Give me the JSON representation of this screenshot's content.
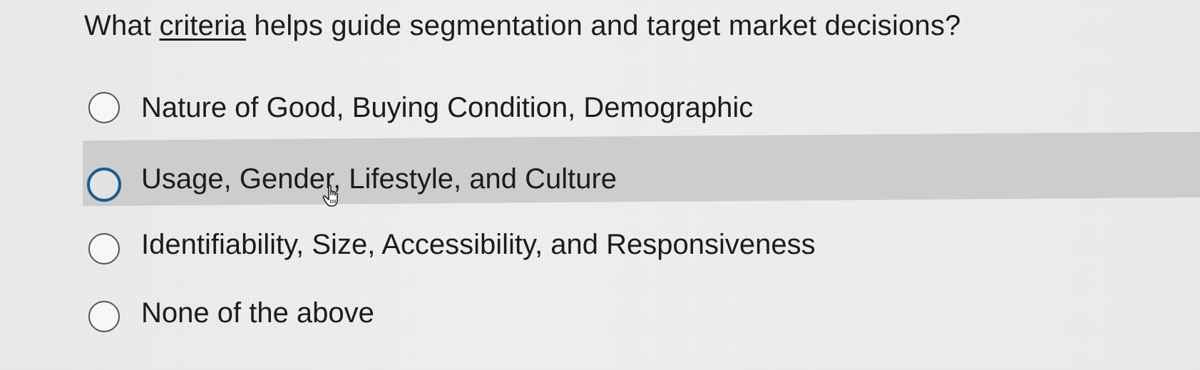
{
  "question": {
    "prefix": "What ",
    "emphasis": "criteria",
    "suffix": " helps guide segmentation and target market decisions?"
  },
  "options": [
    {
      "label": "Nature of Good, Buying Condition, Demographic",
      "selected": false
    },
    {
      "label": "Usage, Gender, Lifestyle, and Culture",
      "selected": false,
      "hovered": true
    },
    {
      "label": "Identifiability, Size, Accessibility, and Responsiveness",
      "selected": false
    },
    {
      "label": "None of the above",
      "selected": false
    }
  ],
  "colors": {
    "hover_row": "#cdcdcd",
    "focus_ring": "#1a5c8e"
  },
  "icons": {
    "cursor": "hand-pointer-icon",
    "radio": "radio-button-icon"
  }
}
